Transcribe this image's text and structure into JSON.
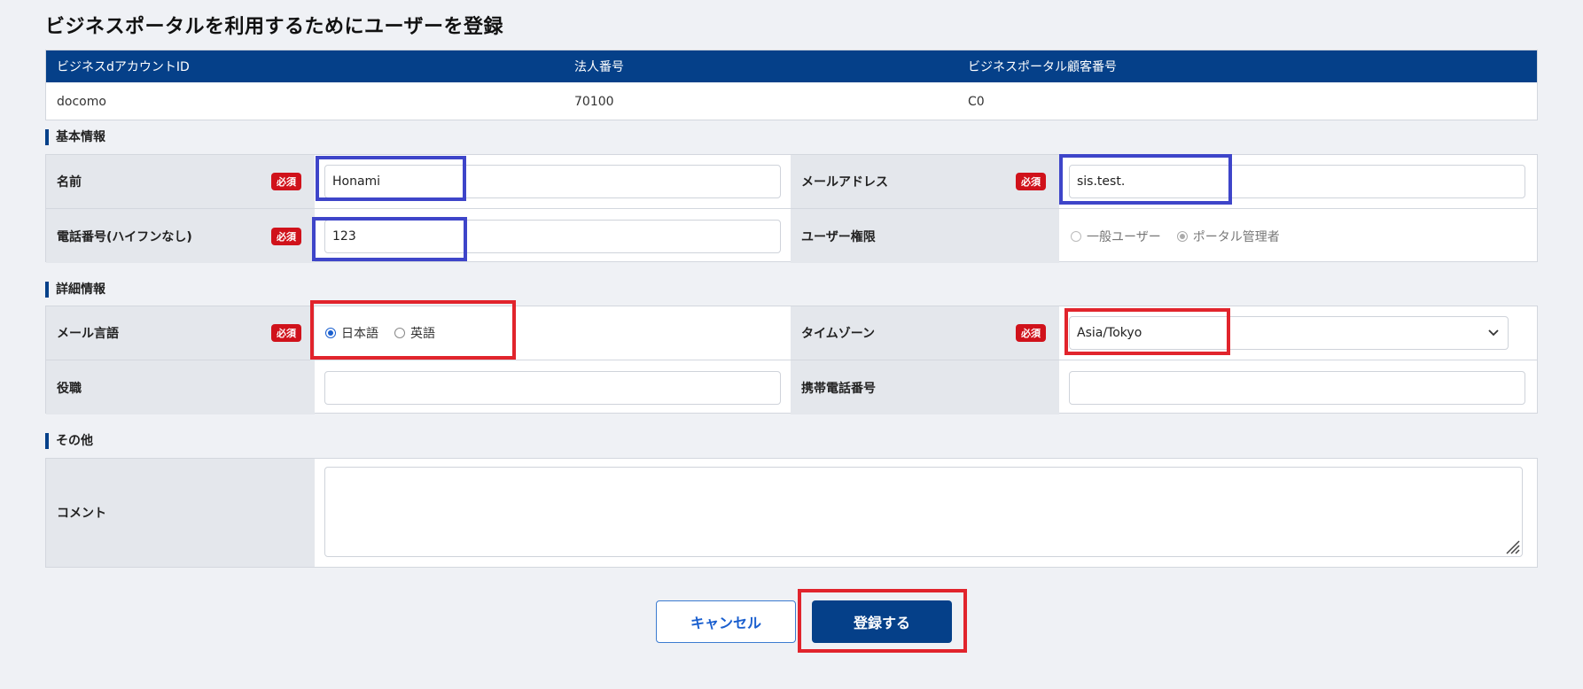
{
  "page_title": "ビジネスポータルを利用するためにユーザーを登録",
  "account": {
    "headers": [
      "ビジネスdアカウントID",
      "法人番号",
      "ビジネスポータル顧客番号"
    ],
    "values": [
      "docomo",
      "70100",
      "C0"
    ]
  },
  "sections": {
    "basic": "基本情報",
    "detail": "詳細情報",
    "other": "その他"
  },
  "required_badge": "必須",
  "basic": {
    "name_label": "名前",
    "name_value": "Honami",
    "email_label": "メールアドレス",
    "email_value": "sis.test.",
    "phone_label": "電話番号(ハイフンなし)",
    "phone_value": "123",
    "role_label": "ユーザー権限",
    "role_options": [
      "一般ユーザー",
      "ポータル管理者"
    ],
    "role_selected": "ポータル管理者"
  },
  "detail": {
    "mail_lang_label": "メール言語",
    "mail_lang_options": [
      "日本語",
      "英語"
    ],
    "mail_lang_selected": "日本語",
    "timezone_label": "タイムゾーン",
    "timezone_value": "Asia/Tokyo",
    "position_label": "役職",
    "position_value": "",
    "mobile_label": "携帯電話番号",
    "mobile_value": ""
  },
  "other": {
    "comment_label": "コメント",
    "comment_value": ""
  },
  "buttons": {
    "cancel": "キャンセル",
    "submit": "登録する"
  },
  "colors": {
    "header_blue": "#054089",
    "required_red": "#d0121b",
    "highlight_blue": "#3e45c9",
    "highlight_red": "#e1242c"
  }
}
